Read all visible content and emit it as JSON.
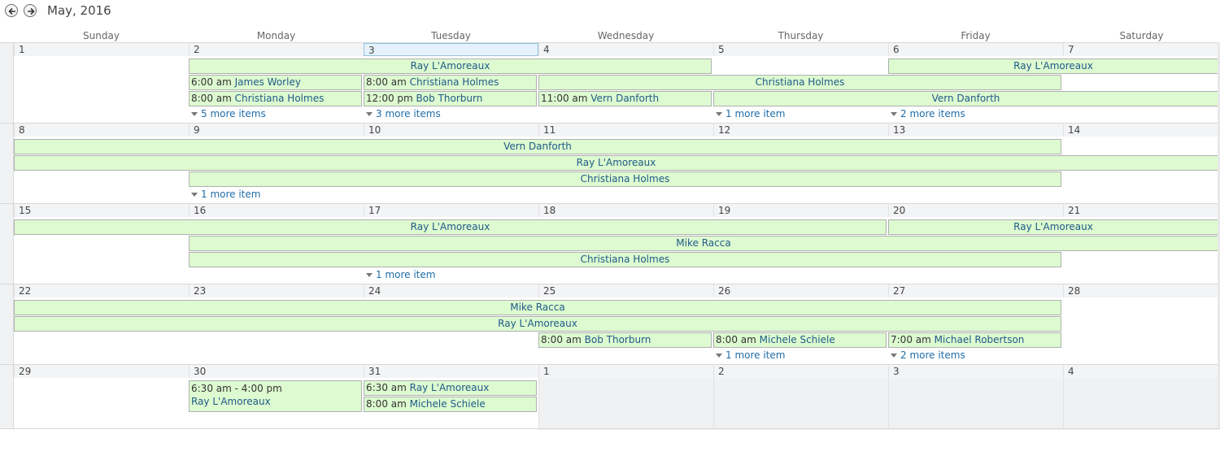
{
  "header": {
    "title": "May, 2016",
    "prev_icon": "arrow-left-icon",
    "next_icon": "arrow-right-icon"
  },
  "day_names": [
    "Sunday",
    "Monday",
    "Tuesday",
    "Wednesday",
    "Thursday",
    "Friday",
    "Saturday"
  ],
  "colors": {
    "event_bg": "#ddfad0",
    "event_text": "#1f5b88",
    "link": "#1f6da8",
    "today_border": "#92c0e0"
  },
  "weeks": [
    {
      "days": [
        "1",
        "2",
        "3",
        "4",
        "5",
        "6",
        "7"
      ],
      "today_index": 2,
      "outside_from": null,
      "events": [
        {
          "start": 1,
          "end": 3,
          "row": 0,
          "label": "Ray L'Amoreaux"
        },
        {
          "start": 5,
          "end": 6,
          "row": 0,
          "label": "Ray L'Amoreaux"
        },
        {
          "start": 1,
          "end": 1,
          "row": 1,
          "time": "6:00 am",
          "label": "James Worley"
        },
        {
          "start": 2,
          "end": 2,
          "row": 1,
          "time": "8:00 am",
          "label": "Christiana Holmes"
        },
        {
          "start": 3,
          "end": 5,
          "row": 1,
          "label": "Christiana Holmes"
        },
        {
          "start": 1,
          "end": 1,
          "row": 2,
          "time": "8:00 am",
          "label": "Christiana Holmes"
        },
        {
          "start": 2,
          "end": 2,
          "row": 2,
          "time": "12:00 pm",
          "label": "Bob Thorburn"
        },
        {
          "start": 3,
          "end": 3,
          "row": 2,
          "time": "11:00 am",
          "label": "Vern Danforth"
        },
        {
          "start": 4,
          "end": 6,
          "row": 2,
          "label": "Vern Danforth"
        }
      ],
      "more": [
        {
          "col": 1,
          "label": "5 more items"
        },
        {
          "col": 2,
          "label": "3 more items"
        },
        {
          "col": 4,
          "label": "1 more item"
        },
        {
          "col": 5,
          "label": "2 more items"
        }
      ]
    },
    {
      "days": [
        "8",
        "9",
        "10",
        "11",
        "12",
        "13",
        "14"
      ],
      "today_index": null,
      "outside_from": null,
      "events": [
        {
          "start": 0,
          "end": 5,
          "row": 0,
          "label": "Vern Danforth"
        },
        {
          "start": 0,
          "end": 6,
          "row": 1,
          "label": "Ray L'Amoreaux"
        },
        {
          "start": 1,
          "end": 5,
          "row": 2,
          "label": "Christiana Holmes"
        }
      ],
      "more": [
        {
          "col": 1,
          "label": "1 more item"
        }
      ]
    },
    {
      "days": [
        "15",
        "16",
        "17",
        "18",
        "19",
        "20",
        "21"
      ],
      "today_index": null,
      "outside_from": null,
      "events": [
        {
          "start": 0,
          "end": 4,
          "row": 0,
          "label": "Ray L'Amoreaux"
        },
        {
          "start": 5,
          "end": 6,
          "row": 0,
          "label": "Ray L'Amoreaux"
        },
        {
          "start": 1,
          "end": 6,
          "row": 1,
          "label": "Mike Racca"
        },
        {
          "start": 1,
          "end": 5,
          "row": 2,
          "label": "Christiana Holmes"
        }
      ],
      "more": [
        {
          "col": 2,
          "label": "1 more item"
        }
      ]
    },
    {
      "days": [
        "22",
        "23",
        "24",
        "25",
        "26",
        "27",
        "28"
      ],
      "today_index": null,
      "outside_from": null,
      "events": [
        {
          "start": 0,
          "end": 5,
          "row": 0,
          "label": "Mike Racca"
        },
        {
          "start": 0,
          "end": 5,
          "row": 1,
          "label": "Ray L'Amoreaux"
        },
        {
          "start": 3,
          "end": 3,
          "row": 2,
          "time": "8:00 am",
          "label": "Bob Thorburn"
        },
        {
          "start": 4,
          "end": 4,
          "row": 2,
          "time": "8:00 am",
          "label": "Michele Schiele"
        },
        {
          "start": 5,
          "end": 5,
          "row": 2,
          "time": "7:00 am",
          "label": "Michael Robertson"
        }
      ],
      "more": [
        {
          "col": 4,
          "label": "1 more item"
        },
        {
          "col": 5,
          "label": "2 more items"
        }
      ]
    },
    {
      "days": [
        "29",
        "30",
        "31",
        "1",
        "2",
        "3",
        "4"
      ],
      "today_index": null,
      "outside_from": 3,
      "events": [
        {
          "start": 1,
          "end": 1,
          "row": 0,
          "time": "6:30 am - 4:00 pm",
          "label": "Ray L'Amoreaux",
          "tall": true
        },
        {
          "start": 2,
          "end": 2,
          "row": 0,
          "time": "6:30 am",
          "label": "Ray L'Amoreaux"
        },
        {
          "start": 2,
          "end": 2,
          "row": 1,
          "time": "8:00 am",
          "label": "Michele Schiele"
        }
      ],
      "more": []
    }
  ]
}
